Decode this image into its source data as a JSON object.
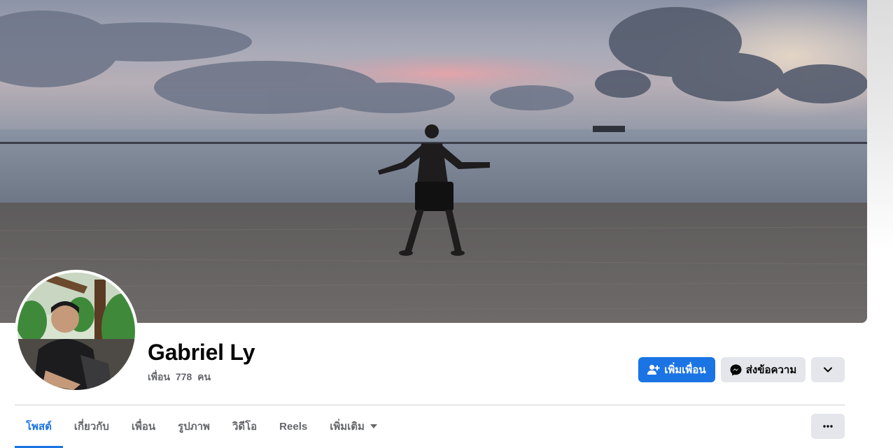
{
  "profile": {
    "name": "Gabriel Ly",
    "friends_label": "เพื่อน",
    "friends_count": "778",
    "friends_unit": "คน"
  },
  "actions": {
    "add_friend": "เพิ่มเพื่อน",
    "message": "ส่งข้อความ"
  },
  "tabs": [
    {
      "label": "โพสต์",
      "active": true
    },
    {
      "label": "เกี่ยวกับ",
      "active": false
    },
    {
      "label": "เพื่อน",
      "active": false
    },
    {
      "label": "รูปภาพ",
      "active": false
    },
    {
      "label": "วิดีโอ",
      "active": false
    },
    {
      "label": "Reels",
      "active": false
    },
    {
      "label": "เพิ่มเติม",
      "active": false
    }
  ],
  "icons": {
    "add_friend": "person-add-icon",
    "message": "messenger-icon",
    "dropdown": "chevron-down-icon",
    "tab_more": "caret-down-icon",
    "overflow": "ellipsis-icon"
  },
  "colors": {
    "accent": "#1b74e4",
    "button_gray": "#e4e6eb",
    "text_primary": "#050505",
    "text_secondary": "#65676b"
  }
}
